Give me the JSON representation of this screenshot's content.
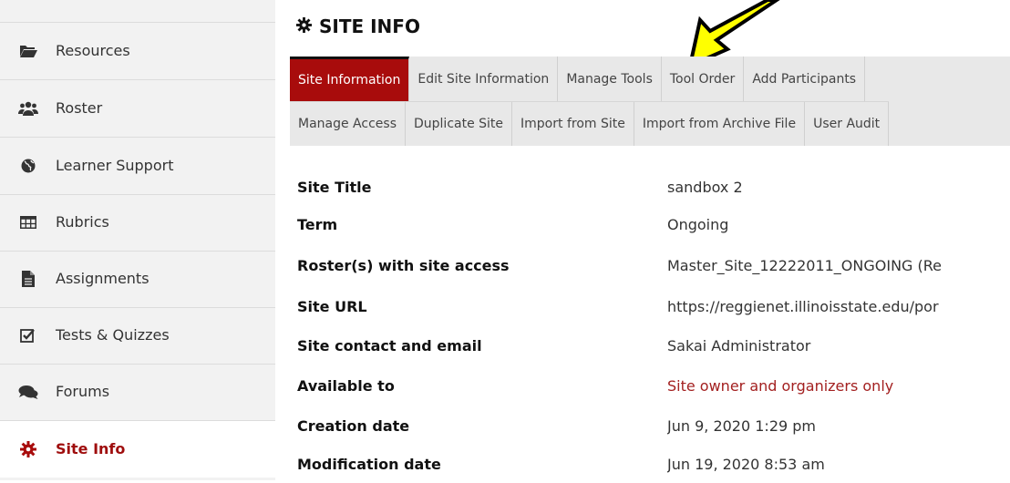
{
  "sidebar": {
    "items": [
      {
        "label": "Resources",
        "icon": "folder-open-icon"
      },
      {
        "label": "Roster",
        "icon": "users-icon"
      },
      {
        "label": "Learner Support",
        "icon": "globe-icon"
      },
      {
        "label": "Rubrics",
        "icon": "table-icon"
      },
      {
        "label": "Assignments",
        "icon": "file-icon"
      },
      {
        "label": "Tests & Quizzes",
        "icon": "check-square-icon"
      },
      {
        "label": "Forums",
        "icon": "comments-icon"
      },
      {
        "label": "Site Info",
        "icon": "gear-icon",
        "active": true
      }
    ]
  },
  "header": {
    "title": "SITE INFO"
  },
  "tabs": {
    "row1": [
      "Site Information",
      "Edit Site Information",
      "Manage Tools",
      "Tool Order",
      "Add Participants"
    ],
    "row2": [
      "Manage Access",
      "Duplicate Site",
      "Import from Site",
      "Import from Archive File",
      "User Audit"
    ]
  },
  "info": {
    "rows": [
      {
        "label": "Site Title",
        "value": "sandbox 2"
      },
      {
        "label": "Term",
        "value": "Ongoing"
      },
      {
        "label": "Roster(s) with site access",
        "value": "Master_Site_12222011_ONGOING (Re"
      },
      {
        "label": "Site URL",
        "value": "https://reggienet.illinoisstate.edu/por"
      },
      {
        "label": "Site contact and email",
        "value": "Sakai Administrator"
      },
      {
        "label": "Available to",
        "value": "Site owner and organizers only"
      },
      {
        "label": "Creation date",
        "value": "Jun 9, 2020 1:29 pm"
      },
      {
        "label": "Modification date",
        "value": "Jun 19, 2020 8:53 am"
      }
    ]
  },
  "colors": {
    "brand": "#a80c0c",
    "alert_text": "#a32020",
    "arrow_fill": "#ffff00"
  }
}
